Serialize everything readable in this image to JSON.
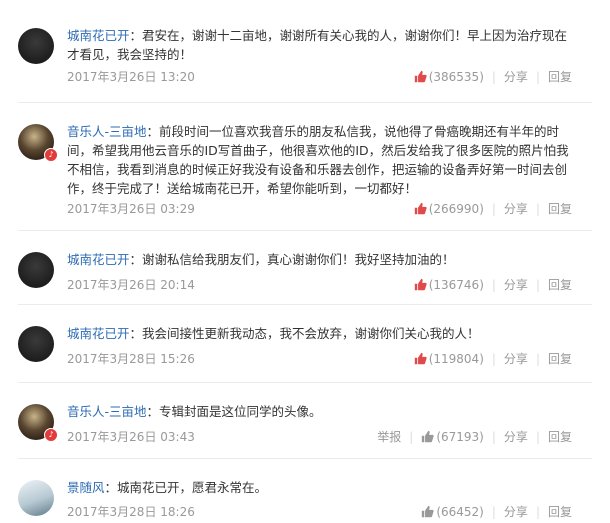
{
  "comments": [
    {
      "username": "城南花已开",
      "text": "君安在，谢谢十二亩地，谢谢所有关心我的人，谢谢你们！早上因为治疗现在才看见，我会坚持的！",
      "date": "2017年3月26日 13:20",
      "likes": "(386535)",
      "share": "分享",
      "reply": "回复"
    },
    {
      "username": "音乐人-三亩地",
      "text": "前段时间一位喜欢我音乐的朋友私信我，说他得了骨癌晚期还有半年的时间，希望我用他云音乐的ID写首曲子，他很喜欢他的ID，然后发给我了很多医院的照片怕我不相信，我看到消息的时候正好我没有设备和乐器去创作，把运输的设备弄好第一时间去创作，终于完成了！送给城南花已开，希望你能听到，一切都好！",
      "date": "2017年3月26日 03:29",
      "likes": "(266990)",
      "share": "分享",
      "reply": "回复"
    },
    {
      "username": "城南花已开",
      "text": "谢谢私信给我朋友们，真心谢谢你们！我好坚持加油的！",
      "date": "2017年3月26日 20:14",
      "likes": "(136746)",
      "share": "分享",
      "reply": "回复"
    },
    {
      "username": "城南花已开",
      "text": "我会间接性更新我动态，我不会放弃，谢谢你们关心我的人！",
      "date": "2017年3月28日 15:26",
      "likes": "(119804)",
      "share": "分享",
      "reply": "回复"
    },
    {
      "username": "音乐人-三亩地",
      "text": "专辑封面是这位同学的头像。",
      "date": "2017年3月26日 03:43",
      "report": "举报",
      "likes": "(67193)",
      "share": "分享",
      "reply": "回复"
    },
    {
      "username": "景随风",
      "text": "城南花已开，愿君永常在。",
      "date": "2017年3月28日 18:26",
      "likes": "(66452)",
      "share": "分享",
      "reply": "回复"
    }
  ],
  "colors": {
    "username": "#2d6bb5",
    "like_active": "#e04a4a",
    "like_inactive": "#999999",
    "meta": "#999999"
  }
}
